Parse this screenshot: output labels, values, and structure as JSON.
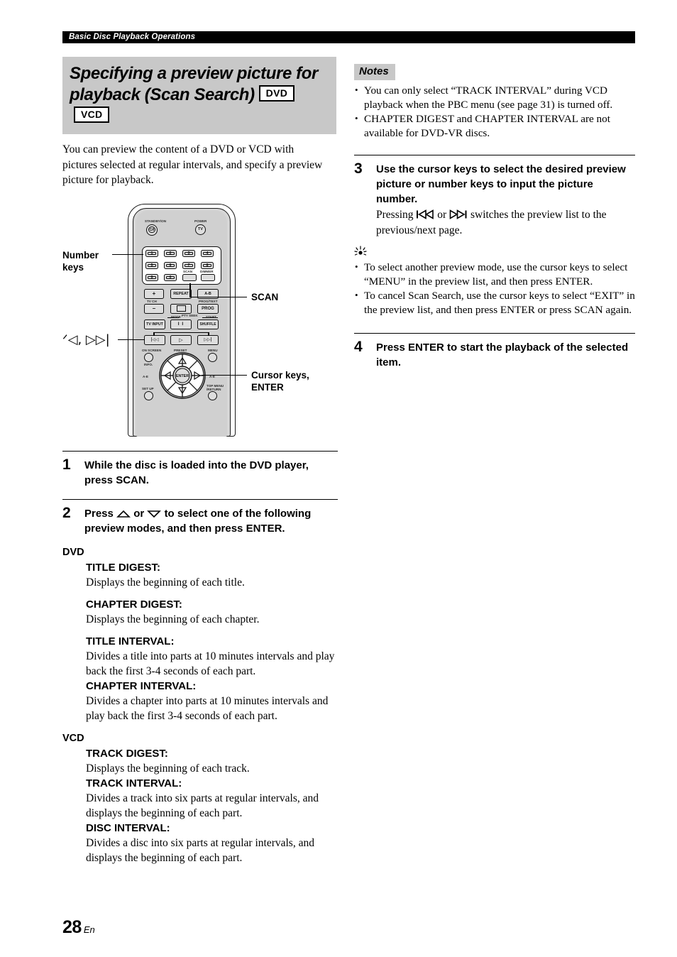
{
  "header": {
    "running_title": "Basic Disc Playback Operations"
  },
  "section": {
    "title_line1": "Specifying a preview picture for",
    "title_line2": "playback (Scan Search)",
    "badges": [
      "DVD",
      "VCD"
    ],
    "intro": "You can preview the content of a DVD or VCD with pictures selected at regular intervals, and specify a preview picture for playback."
  },
  "figure": {
    "callouts": {
      "number_keys_line1": "Number",
      "number_keys_line2": "keys",
      "skip_keys": "ᐟ◁, ▷▷|",
      "scan": "SCAN",
      "cursor_line1": "Cursor keys,",
      "cursor_line2": "ENTER"
    },
    "remote_labels": {
      "standby": "STANDBY/ON",
      "power": "POWER",
      "power_btn": "TV",
      "standby_btn": "⏻/I",
      "scan": "SCAN",
      "dimmer": "DIMMER",
      "repeat": "REPEAT",
      "ab": "A-B",
      "tv_ch": "TV CH",
      "prog_text": "PROG/TEXT",
      "prog": "PROG",
      "plus": "+",
      "minus": "–",
      "mode": "MODE",
      "pty_seek": "PTY SEEK",
      "start": "START",
      "tv_input": "TV INPUT",
      "pause": "I I",
      "shuffle": "SHUFFLE",
      "prev": "|◁◁",
      "play": "▷",
      "next": "▷▷|",
      "on_screen": "ON SCREEN",
      "info": "INFO.",
      "preset": "PRESET",
      "menu": "MENU",
      "ae_left": "A-E",
      "ae_right": "A-E",
      "setup": "SET UP",
      "top_menu_line1": "TOP MENU",
      "top_menu_line2": "/RETURN",
      "enter": "ENTER"
    },
    "number_keys": [
      "1",
      "2",
      "3",
      "4",
      "5",
      "6",
      "7",
      "8",
      "9",
      "0"
    ]
  },
  "steps": [
    {
      "num": "1",
      "title": "While the disc is loaded into the DVD player, press SCAN.",
      "desc": ""
    },
    {
      "num": "2",
      "title_pre": "Press",
      "title_mid": "or",
      "title_post": "to select one of the following preview modes, and then press ENTER.",
      "desc": ""
    },
    {
      "num": "3",
      "title": "Use the cursor keys to select the desired preview picture or number keys to input the picture number.",
      "desc_pre": "Pressing",
      "desc_mid": "or",
      "desc_post": "switches the preview list to the previous/next page."
    },
    {
      "num": "4",
      "title": "Press ENTER to start the playback of the selected item.",
      "desc": ""
    }
  ],
  "modes": [
    {
      "disc": "DVD",
      "items": [
        {
          "name": "TITLE DIGEST:",
          "text": "Displays the beginning of each title."
        },
        {
          "name": "CHAPTER DIGEST:",
          "text": "Displays the beginning of each chapter."
        },
        {
          "name": "TITLE INTERVAL:",
          "text": "Divides a title into parts at 10 minutes intervals and play back the first 3-4 seconds of each part."
        },
        {
          "name": "CHAPTER INTERVAL:",
          "text": "Divides a chapter into parts at 10 minutes intervals and play back the first 3-4 seconds of each part."
        }
      ]
    },
    {
      "disc": "VCD",
      "items": [
        {
          "name": "TRACK DIGEST:",
          "text": "Displays the beginning of each track."
        },
        {
          "name": "TRACK INTERVAL:",
          "text": "Divides a track into six parts at regular intervals, and displays the beginning of each part."
        },
        {
          "name": "DISC INTERVAL:",
          "text": "Divides a disc into six parts at regular intervals, and displays the beginning of each part."
        }
      ]
    }
  ],
  "notes": {
    "tag": "Notes",
    "items": [
      "You can only select “TRACK INTERVAL” during VCD playback when the PBC menu (see page 31) is turned off.",
      "CHAPTER DIGEST and CHAPTER INTERVAL are not available for DVD-VR discs."
    ]
  },
  "tips": {
    "items": [
      "To select another preview mode, use the cursor keys to select “MENU” in the preview list, and then press ENTER.",
      "To cancel Scan Search, use the cursor keys to select “EXIT” in the preview list, and then press ENTER or press SCAN again."
    ]
  },
  "footer": {
    "page_number": "28",
    "lang": "En"
  }
}
